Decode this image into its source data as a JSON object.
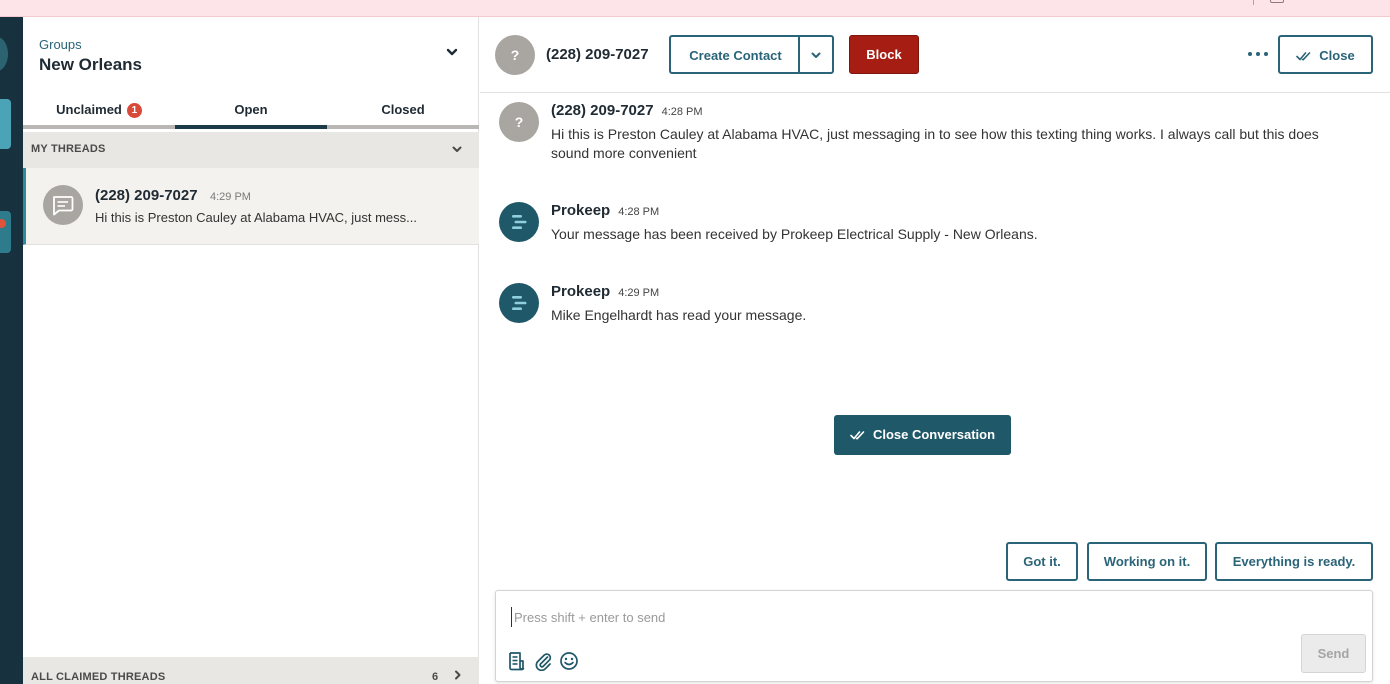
{
  "groups": {
    "label": "Groups",
    "name": "New Orleans"
  },
  "tabs": [
    {
      "label": "Unclaimed",
      "badge": "1"
    },
    {
      "label": "Open"
    },
    {
      "label": "Closed"
    }
  ],
  "my_threads": {
    "label": "MY THREADS"
  },
  "thread": {
    "name": "(228) 209-7027",
    "time": "4:29 PM",
    "preview": "Hi this is Preston Cauley at Alabama HVAC, just mess..."
  },
  "all_claimed": {
    "label": "ALL CLAIMED THREADS",
    "count": "6"
  },
  "conversation": {
    "avatar_glyph": "?",
    "contact": "(228) 209-7027",
    "create_contact": "Create Contact",
    "block": "Block",
    "close": "Close"
  },
  "messages": [
    {
      "sender": "(228) 209-7027",
      "time": "4:28 PM",
      "text": "Hi this is Preston Cauley at Alabama HVAC, just messaging in to see how this texting thing works. I always call but this does sound more convenient"
    },
    {
      "sender": "Prokeep",
      "time": "4:28 PM",
      "text": "Your message has been received by Prokeep Electrical Supply - New Orleans."
    },
    {
      "sender": "Prokeep",
      "time": "4:29 PM",
      "text": "Mike Engelhardt has read your message."
    }
  ],
  "close_conversation": "Close Conversation",
  "quick_replies": [
    "Got it.",
    "Working on it.",
    "Everything is ready."
  ],
  "composer": {
    "placeholder": "Press shift + enter to send",
    "send": "Send"
  },
  "colors": {
    "accent": "#2a6478",
    "danger": "#a61d13",
    "rail": "#18313f",
    "badge": "#d94a3a"
  }
}
